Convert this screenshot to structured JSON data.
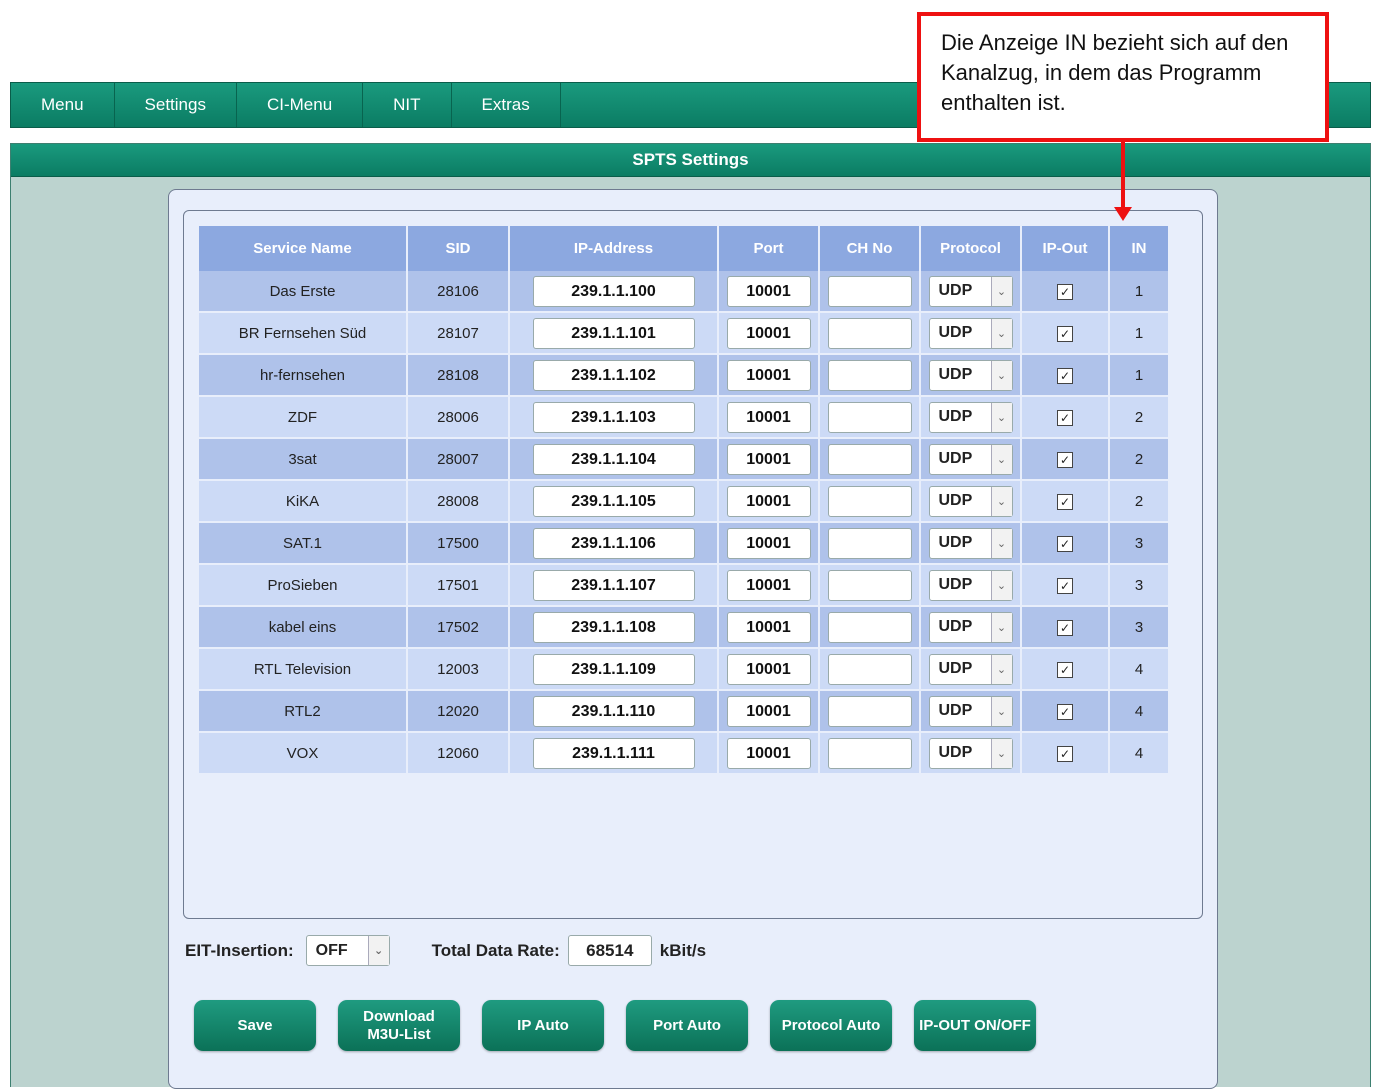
{
  "callout": {
    "text": "Die Anzeige IN bezieht sich auf den Kanalzug, in dem das Programm enthalten ist."
  },
  "nav": {
    "items": [
      "Menu",
      "Settings",
      "CI-Menu",
      "NIT",
      "Extras"
    ]
  },
  "panel": {
    "title": "SPTS Settings"
  },
  "table": {
    "headers": [
      "Service Name",
      "SID",
      "IP-Address",
      "Port",
      "CH No",
      "Protocol",
      "IP-Out",
      "IN"
    ],
    "rows": [
      {
        "name": "Das Erste",
        "sid": "28106",
        "ip": "239.1.1.100",
        "port": "10001",
        "ch": "",
        "protocol": "UDP",
        "ipout": true,
        "in": "1"
      },
      {
        "name": "BR Fernsehen Süd",
        "sid": "28107",
        "ip": "239.1.1.101",
        "port": "10001",
        "ch": "",
        "protocol": "UDP",
        "ipout": true,
        "in": "1"
      },
      {
        "name": "hr-fernsehen",
        "sid": "28108",
        "ip": "239.1.1.102",
        "port": "10001",
        "ch": "",
        "protocol": "UDP",
        "ipout": true,
        "in": "1"
      },
      {
        "name": "ZDF",
        "sid": "28006",
        "ip": "239.1.1.103",
        "port": "10001",
        "ch": "",
        "protocol": "UDP",
        "ipout": true,
        "in": "2"
      },
      {
        "name": "3sat",
        "sid": "28007",
        "ip": "239.1.1.104",
        "port": "10001",
        "ch": "",
        "protocol": "UDP",
        "ipout": true,
        "in": "2"
      },
      {
        "name": "KiKA",
        "sid": "28008",
        "ip": "239.1.1.105",
        "port": "10001",
        "ch": "",
        "protocol": "UDP",
        "ipout": true,
        "in": "2"
      },
      {
        "name": "SAT.1",
        "sid": "17500",
        "ip": "239.1.1.106",
        "port": "10001",
        "ch": "",
        "protocol": "UDP",
        "ipout": true,
        "in": "3"
      },
      {
        "name": "ProSieben",
        "sid": "17501",
        "ip": "239.1.1.107",
        "port": "10001",
        "ch": "",
        "protocol": "UDP",
        "ipout": true,
        "in": "3"
      },
      {
        "name": "kabel eins",
        "sid": "17502",
        "ip": "239.1.1.108",
        "port": "10001",
        "ch": "",
        "protocol": "UDP",
        "ipout": true,
        "in": "3"
      },
      {
        "name": "RTL Television",
        "sid": "12003",
        "ip": "239.1.1.109",
        "port": "10001",
        "ch": "",
        "protocol": "UDP",
        "ipout": true,
        "in": "4"
      },
      {
        "name": "RTL2",
        "sid": "12020",
        "ip": "239.1.1.110",
        "port": "10001",
        "ch": "",
        "protocol": "UDP",
        "ipout": true,
        "in": "4"
      },
      {
        "name": "VOX",
        "sid": "12060",
        "ip": "239.1.1.111",
        "port": "10001",
        "ch": "",
        "protocol": "UDP",
        "ipout": true,
        "in": "4"
      }
    ]
  },
  "eit": {
    "label": "EIT-Insertion:",
    "value": "OFF"
  },
  "rate": {
    "label": "Total Data Rate:",
    "value": "68514",
    "unit": "kBit/s"
  },
  "buttons": [
    "Save",
    "Download\nM3U-List",
    "IP Auto",
    "Port Auto",
    "Protocol Auto",
    "IP-OUT ON/OFF"
  ],
  "icons": {
    "checkbox": "checkbox-checked-icon",
    "dropdown": "chevron-down-icon"
  },
  "colors": {
    "accent": "#0b7c63",
    "annotation": "#ee1111",
    "header": "#8ca8e0"
  }
}
